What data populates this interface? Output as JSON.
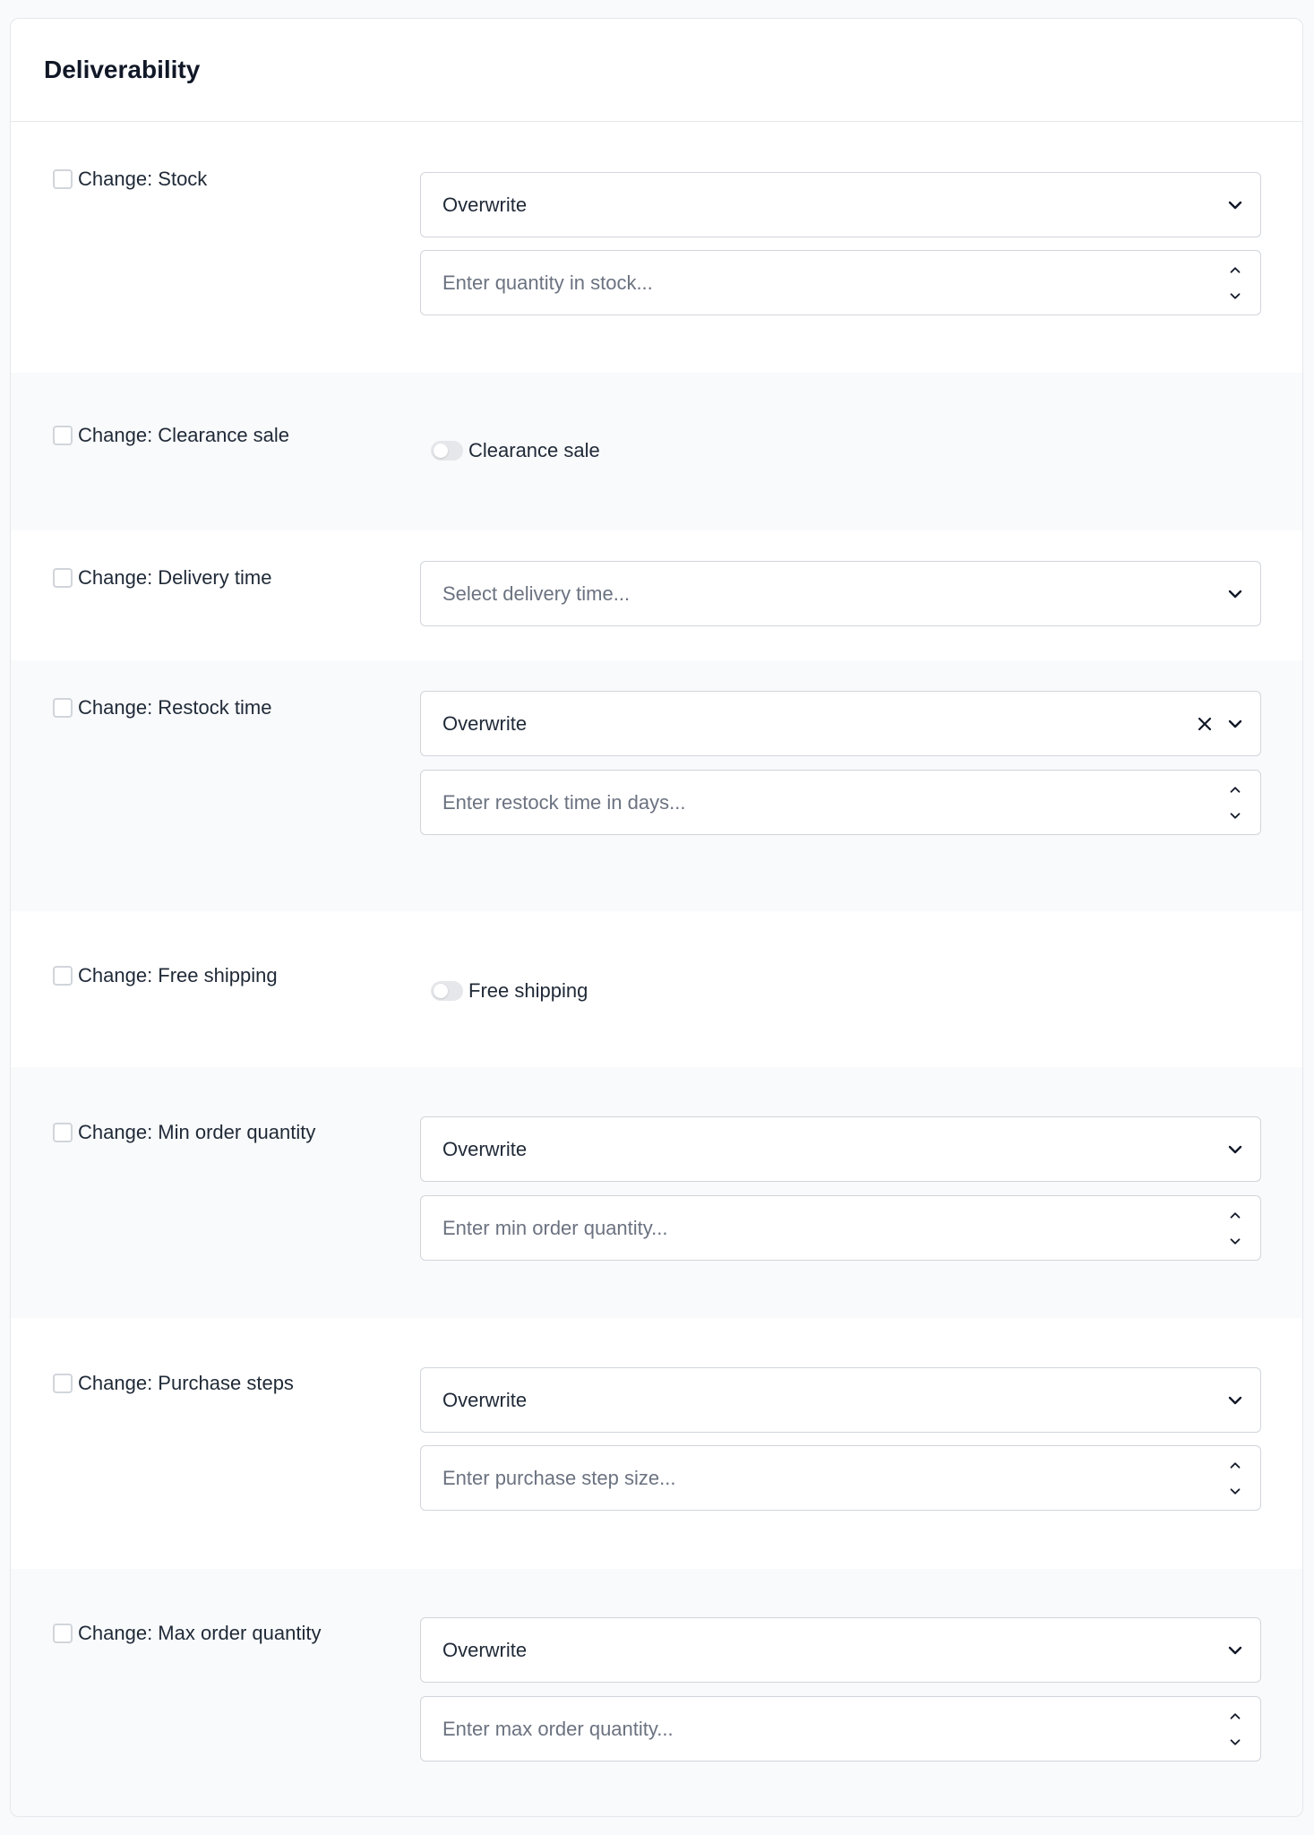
{
  "card": {
    "title": "Deliverability"
  },
  "rows": {
    "stock": {
      "label": "Change: Stock",
      "mode": "Overwrite",
      "placeholder": "Enter quantity in stock..."
    },
    "clearance_sale": {
      "label": "Change: Clearance sale",
      "toggle_label": "Clearance sale",
      "toggle_on": false
    },
    "delivery_time": {
      "label": "Change: Delivery time",
      "placeholder": "Select delivery time..."
    },
    "restock_time": {
      "label": "Change: Restock time",
      "mode": "Overwrite",
      "placeholder": "Enter restock time in days..."
    },
    "free_shipping": {
      "label": "Change: Free shipping",
      "toggle_label": "Free shipping",
      "toggle_on": false
    },
    "min_order_quantity": {
      "label": "Change: Min order quantity",
      "mode": "Overwrite",
      "placeholder": "Enter min order quantity..."
    },
    "purchase_steps": {
      "label": "Change: Purchase steps",
      "mode": "Overwrite",
      "placeholder": "Enter purchase step size..."
    },
    "max_order_quantity": {
      "label": "Change: Max order quantity",
      "mode": "Overwrite",
      "placeholder": "Enter max order quantity..."
    }
  },
  "icons": {
    "select": "chevron-down-icon",
    "clear": "close-icon",
    "increment": "chevron-up-icon",
    "decrement": "chevron-down-icon"
  },
  "colors": {
    "border": "#d1d5db",
    "row_alt_background": "#f9fafb",
    "text": "#1f2937",
    "placeholder": "#6b7280",
    "toggle_off": "#e5e7eb"
  }
}
